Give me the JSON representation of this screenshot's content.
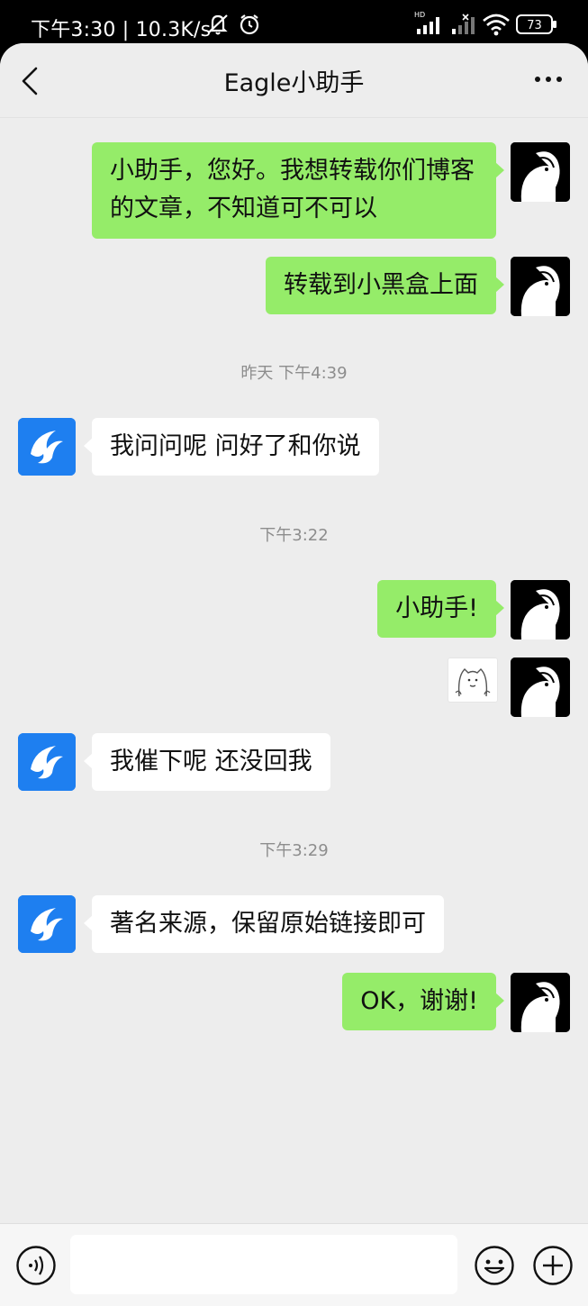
{
  "status_bar": {
    "text": "下午3:30 | 10.3K/s",
    "battery": "73",
    "hd_label": "HD"
  },
  "header": {
    "title": "Eagle小助手"
  },
  "messages": [
    {
      "sender": "me",
      "lines": [
        "小助手，您好。我想转载你们博客",
        "的文章，不知道可不可以"
      ]
    },
    {
      "sender": "me",
      "text": "转载到小黑盒上面"
    },
    {
      "type": "timestamp",
      "text": "昨天 下午4:39"
    },
    {
      "sender": "them",
      "text": "我问问呢 问好了和你说"
    },
    {
      "type": "timestamp",
      "text": "下午3:22"
    },
    {
      "sender": "me",
      "text": "小助手!"
    },
    {
      "sender": "me",
      "type": "sticker",
      "icon": "cat-sticker-icon"
    },
    {
      "sender": "them",
      "text": "我催下呢 还没回我"
    },
    {
      "type": "timestamp",
      "text": "下午3:29"
    },
    {
      "sender": "them",
      "text": "著名来源，保留原始链接即可"
    },
    {
      "sender": "me",
      "text": "OK，谢谢!"
    }
  ],
  "input_bar": {
    "value": "",
    "placeholder": ""
  },
  "colors": {
    "my_bubble": "#95ec69",
    "their_bubble": "#ffffff",
    "chat_background": "#ededed",
    "bot_avatar": "#1e7ff0"
  }
}
